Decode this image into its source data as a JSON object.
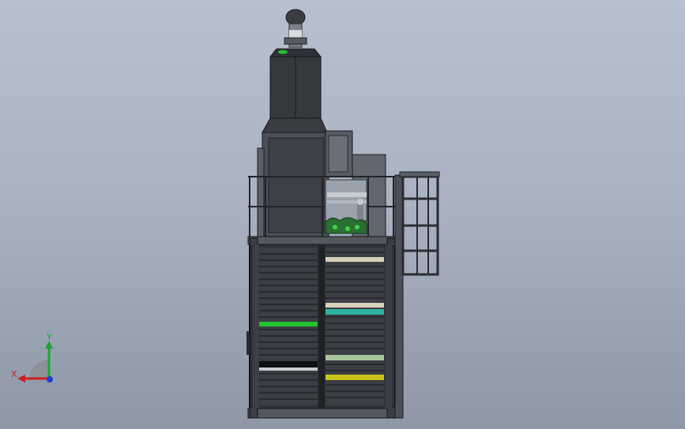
{
  "colors": {
    "background_top": "#b7c0ce",
    "background_bottom": "#8e97a6",
    "steel_dark": "#2f3237",
    "steel_mid": "#4b4f56",
    "steel_light": "#6b7078",
    "band_green": "#22c22e",
    "band_cyan": "#2bb3a0",
    "band_yellow": "#c8c21a",
    "band_cream": "#d6d1ba",
    "band_sage": "#a8c49a",
    "axis_x": "#cc1f1f",
    "axis_y": "#1ea33a",
    "axis_z": "#1d3fd0"
  },
  "triad": {
    "x_label": "X",
    "y_label": "Y"
  }
}
